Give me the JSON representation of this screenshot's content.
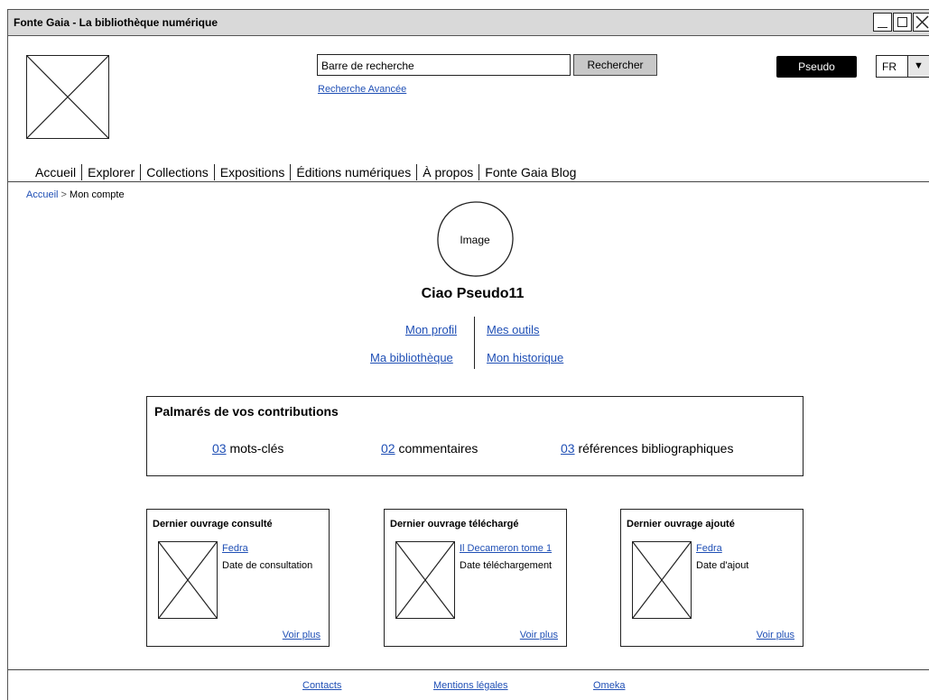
{
  "window": {
    "title": "Fonte Gaia - La bibliothèque numérique"
  },
  "header": {
    "search_value": "Barre de recherche",
    "search_button": "Rechercher",
    "advanced_search": "Recherche Avancée",
    "user_button": "Pseudo",
    "language": "FR",
    "language_arrow": "▼"
  },
  "nav": {
    "items": [
      "Accueil",
      "Explorer",
      "Collections",
      "Expositions",
      "Éditions numériques",
      "À propos",
      "Fonte Gaia Blog"
    ]
  },
  "breadcrumb": {
    "home": "Accueil",
    "separator": ">",
    "current": "Mon compte"
  },
  "profile": {
    "image_label": "Image",
    "greeting": "Ciao Pseudo11",
    "links": {
      "profile": "Mon profil",
      "tools": "Mes outils",
      "library": "Ma bibliothèque",
      "history": "Mon historique"
    }
  },
  "contributions": {
    "title": "Palmarés de vos contributions",
    "stats": [
      {
        "count": "03",
        "label": "mots-clés"
      },
      {
        "count": "02",
        "label": "commentaires"
      },
      {
        "count": "03",
        "label": "références bibliographiques"
      }
    ]
  },
  "cards": [
    {
      "title": "Dernier ouvrage consulté",
      "work": "Fedra",
      "date_label": "Date de consultation",
      "more": "Voir plus"
    },
    {
      "title": "Dernier ouvrage téléchargé",
      "work": "Il Decameron tome 1",
      "date_label": "Date téléchargement",
      "more": "Voir plus"
    },
    {
      "title": "Dernier ouvrage ajouté",
      "work": "Fedra",
      "date_label": "Date d'ajout",
      "more": "Voir plus"
    }
  ],
  "footer": {
    "links": [
      "Contacts",
      "Mentions légales",
      "Omeka"
    ]
  },
  "colors": {
    "link": "#1f4fb5",
    "titlebar": "#d9d9d9",
    "button_gray": "#c8c8c8",
    "user_button": "#000000"
  }
}
